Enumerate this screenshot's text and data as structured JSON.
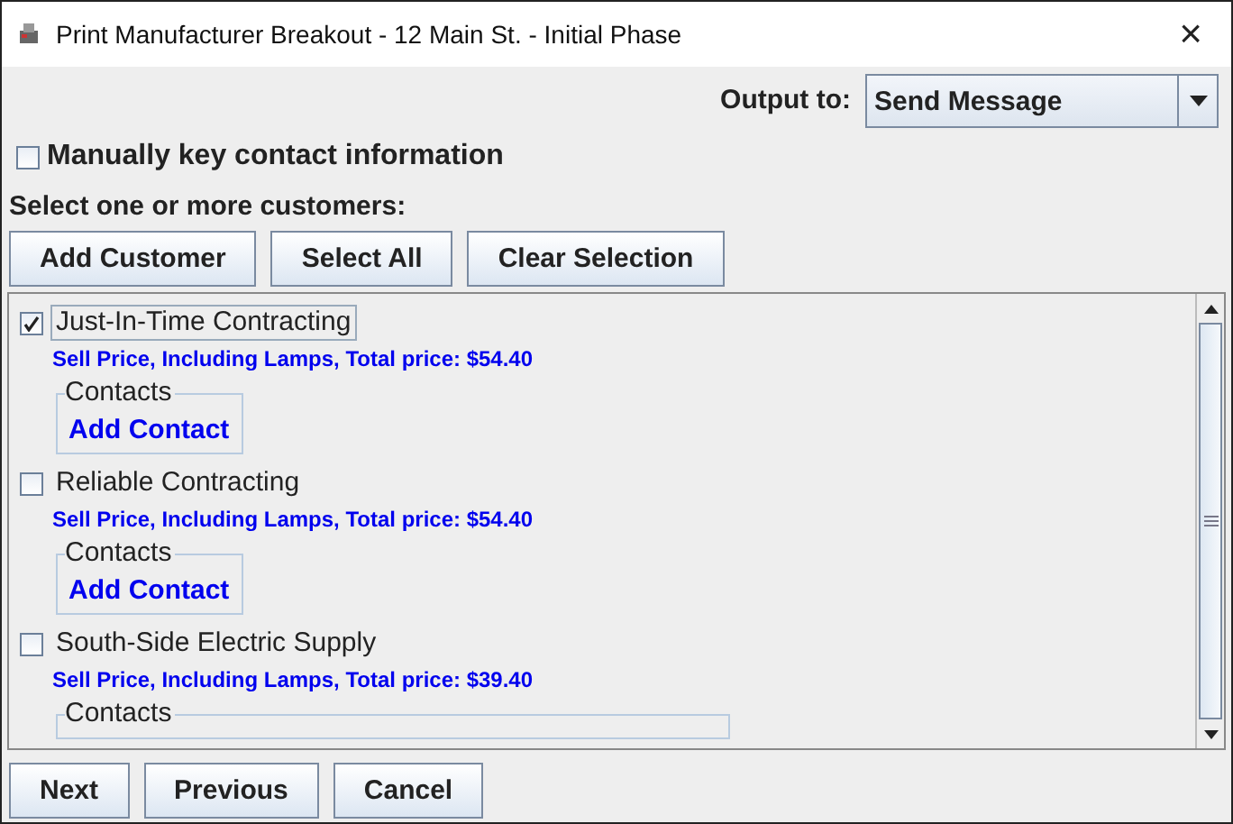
{
  "window": {
    "title": "Print Manufacturer Breakout - 12 Main St. - Initial Phase",
    "close": "×"
  },
  "output": {
    "label": "Output to:",
    "value": "Send Message"
  },
  "manual_key": {
    "label": "Manually key contact information",
    "checked": false
  },
  "select_label": "Select one or more customers:",
  "toolbar": [
    "Add Customer",
    "Select All",
    "Clear Selection"
  ],
  "customers": [
    {
      "name": "Just-In-Time Contracting",
      "checked": true,
      "focused": true,
      "price": "Sell Price, Including Lamps, Total price: $54.40",
      "contacts_title": "Contacts",
      "add_contact": "Add Contact"
    },
    {
      "name": "Reliable Contracting",
      "checked": false,
      "focused": false,
      "price": "Sell Price, Including Lamps, Total price: $54.40",
      "contacts_title": "Contacts",
      "add_contact": "Add Contact"
    },
    {
      "name": "South-Side Electric Supply",
      "checked": false,
      "focused": false,
      "price": "Sell Price, Including Lamps, Total price: $39.40",
      "contacts_title": "Contacts"
    }
  ],
  "buttons": [
    "Next",
    "Previous",
    "Cancel"
  ]
}
